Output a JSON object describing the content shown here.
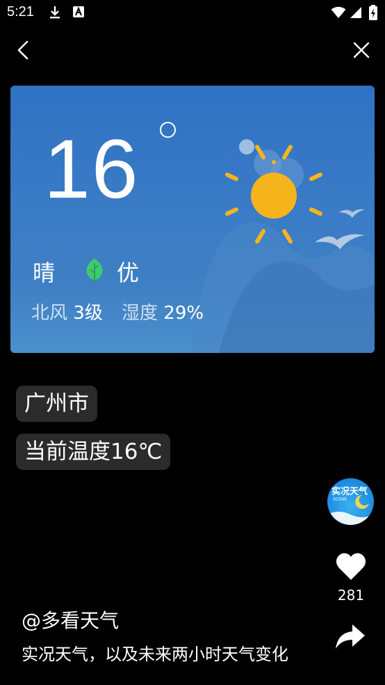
{
  "status_bar": {
    "time": "5:21"
  },
  "weather_card": {
    "temperature": "16",
    "condition": "晴",
    "air_quality": "优",
    "wind_label": "北风",
    "wind_value": "3级",
    "humidity_label": "湿度",
    "humidity_value": "29%"
  },
  "tags": {
    "city": "广州市",
    "current_temp": "当前温度16℃"
  },
  "app_logo": {
    "title": "实况天气",
    "subtitle": "SCENE"
  },
  "actions": {
    "like_count": "281"
  },
  "post": {
    "author": "@多看天气",
    "description": "实况天气，以及未来两小时天气变化"
  },
  "icons": [
    "download-icon",
    "font-icon",
    "wifi-icon",
    "signal-icon",
    "battery-icon",
    "back-icon",
    "close-icon",
    "sun-icon",
    "leaf-icon",
    "heart-icon",
    "share-icon"
  ],
  "colors": {
    "card_top": "#2f72c2",
    "card_bottom": "#4b8fcc",
    "sun": "#f6b41c",
    "leaf": "#3ecb6e",
    "tag_bg": "#2b2b2b"
  }
}
